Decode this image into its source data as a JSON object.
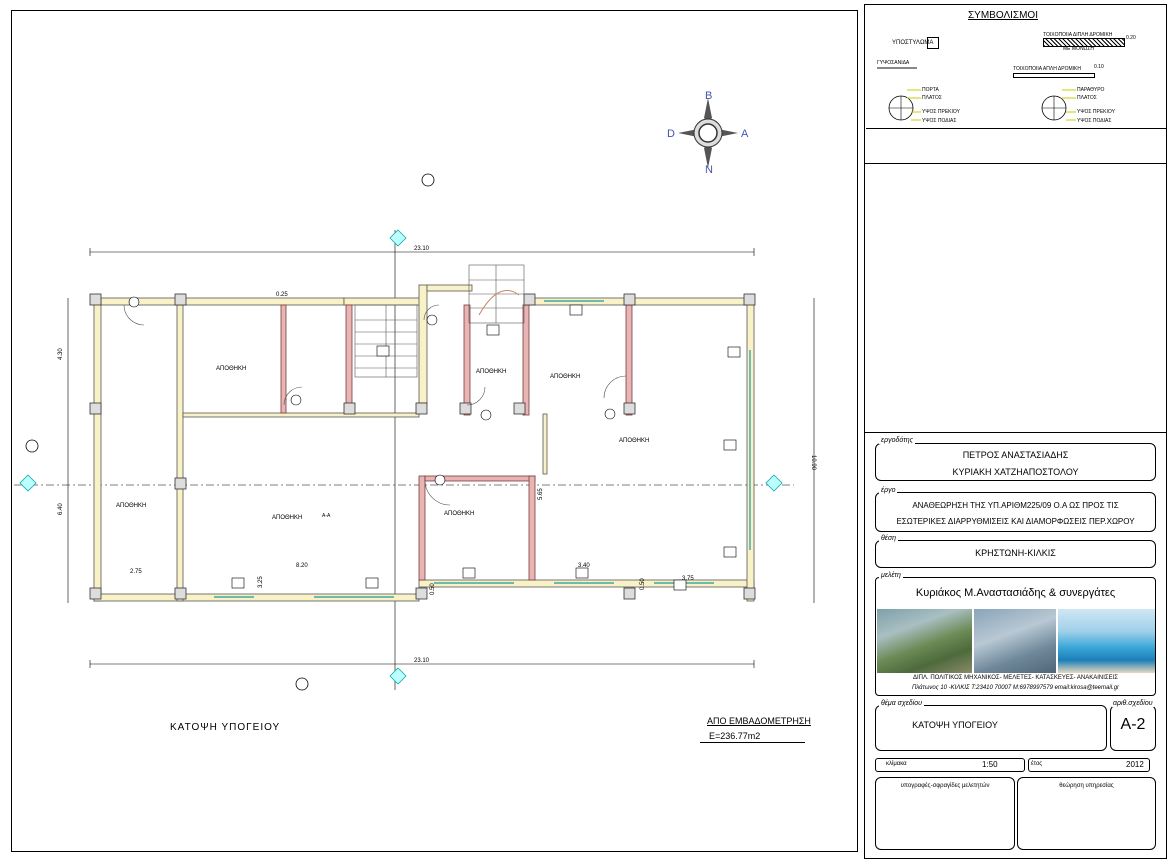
{
  "legend": {
    "title": "ΣΥΜΒΟΛΙΣΜΟΙ",
    "column": "ΥΠΟΣΤΥΛΩΜΑ",
    "wall_double": "ΤΟΙΧΟΠΟΙΙΑ ΔΙΠΛΗ ΔΡΟΜΙΚΗ",
    "wall_double_thk": "0.20",
    "insulation": "ΜΕ ΜΟΝΩΣΗ",
    "glass": "ΓΥΨΟΣΑΝΙΔΑ",
    "wall_single": "ΤΟΙΧΟΠΟΙΙΑ ΑΠΛΗ ΔΡΟΜΙΚΗ",
    "wall_single_thk": "0.10",
    "door_items": [
      "ΠΟΡΤΑ",
      "ΠΛΑΤΟΣ",
      "ΥΨΟΣ ΠΡΕΚΙΟΥ",
      "ΥΨΟΣ ΠΟΔΙΑΣ"
    ],
    "window_items": [
      "ΠΑΡΑΘΥΡΟ",
      "ΠΛΑΤΟΣ",
      "ΥΨΟΣ ΠΡΕΚΙΟΥ",
      "ΥΨΟΣ ΠΟΔΙΑΣ"
    ]
  },
  "compass": {
    "n": "N",
    "s": "B",
    "e": "A",
    "w": "D"
  },
  "plan": {
    "dim_top": "23.10",
    "dim_bottom": "23.10",
    "dim_left_upper": "4.30",
    "dim_left_lower": "6.40",
    "dim_right": "10.90",
    "dim_275": "2.75",
    "dim_820": "8.20",
    "dim_340": "3.40",
    "dim_375": "3.75",
    "dim_325": "3.25",
    "dim_mid": "0.25",
    "dim_585": "5.65",
    "dim_050": "0.50",
    "dim_0": "0.50",
    "rooms": [
      "ΑΠΟΘΗΚΗ",
      "ΑΠΟΘΗΚΗ",
      "ΑΠΟΘΗΚΗ",
      "ΑΠΟΘΗΚΗ",
      "ΑΠΟΘΗΚΗ",
      "ΑΠΟΘΗΚΗ",
      "ΑΠΟΘΗΚΗ"
    ],
    "room_small_label": "Α-Α",
    "title": "ΚΑΤΟΨΗ ΥΠΟΓΕΙΟΥ",
    "area_title": "ΑΠΟ ΕΜΒΑΔΟΜΕΤΡΗΣΗ",
    "area_value": "E=236.77m2"
  },
  "titleblock": {
    "client_label": "εργοδότης",
    "client_1": "ΠΕΤΡΟΣ ΑΝΑΣΤΑΣΙΑΔΗΣ",
    "client_2": "ΚΥΡΙΑΚΗ ΧΑΤΖΗΑΠΟΣΤΟΛΟΥ",
    "project_label": "έργο",
    "project_1": "ΑΝΑΘΕΩΡΗΣΗ ΤΗΣ ΥΠ.ΑΡΙΘΜ225/09 Ο.Α ΩΣ ΠΡΟΣ ΤΙΣ",
    "project_2": "ΕΣΩΤΕΡΙΚΕΣ ΔΙΑΡΡΥΘΜΙΣΕΙΣ ΚΑΙ ΔΙΑΜΟΡΦΩΣΕΙΣ ΠΕΡ.ΧΩΡΟΥ",
    "location_label": "θέση",
    "location": "ΚΡΗΣΤΩΝΗ-ΚΙΛΚΙΣ",
    "study_label": "μελέτη",
    "study_firm": "Κυριάκος Μ.Αναστασιάδης & συνεργάτες",
    "study_desc": "ΔΙΠΛ. ΠΟΛΙΤΙΚΟΣ ΜΗΧΑΝΙΚΟΣ- ΜΕΛΕΤΕΣ- ΚΑΤΑΣΚΕΥΕΣ- ΑΝΑΚΑΙΝΙΣΕΙΣ",
    "study_contact": "Πλάτωνος 10 -ΚΙΛΚΙΣ Τ:23410 70007 Μ:6978997579 email:kirosa@teemail.gr",
    "subject_label": "θέμα σχεδίου",
    "subject": "ΚΑΤΟΨΗ ΥΠΟΓΕΙΟΥ",
    "drawing_no_label": "αριθ.σχεδίου",
    "drawing_no": "Α-2",
    "scale_label": "κλίμακα",
    "scale": "1:50",
    "year_label": "έτος",
    "year": "2012",
    "signatures_label": "υπογραφές-σφραγίδες μελετητών",
    "approval_label": "θεώρηση υπηρεσίας"
  }
}
